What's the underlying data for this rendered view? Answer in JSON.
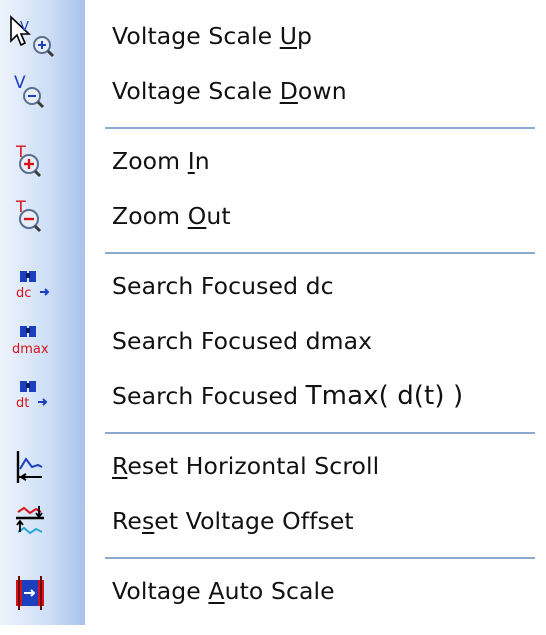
{
  "menu": {
    "items": [
      {
        "id": "voltage-scale-up",
        "pre": "Voltage Scale ",
        "key": "U",
        "post": "p",
        "icon": "voltage-scale-up-icon"
      },
      {
        "id": "voltage-scale-down",
        "pre": "Voltage Scale ",
        "key": "D",
        "post": "own",
        "icon": "voltage-scale-down-icon"
      },
      {
        "id": "zoom-in",
        "pre": "Zoom ",
        "key": "I",
        "post": "n",
        "icon": "zoom-in-icon"
      },
      {
        "id": "zoom-out",
        "pre": "Zoom ",
        "key": "O",
        "post": "ut",
        "icon": "zoom-out-icon"
      },
      {
        "id": "search-focused-dc",
        "label": "Search Focused dc",
        "icon": "binoculars-dc-icon"
      },
      {
        "id": "search-focused-dmax",
        "label": "Search Focused dmax",
        "icon": "binoculars-dmax-icon"
      },
      {
        "id": "search-focused-tmax",
        "pre": "Search Focused ",
        "big": "Tmax( d(t) )",
        "icon": "binoculars-dt-icon"
      },
      {
        "id": "reset-horizontal-scroll",
        "pre": "",
        "key": "R",
        "post": "eset Horizontal Scroll",
        "icon": "reset-horizontal-scroll-icon"
      },
      {
        "id": "reset-voltage-offset",
        "pre": "Re",
        "key": "s",
        "post": "et Voltage Offset",
        "icon": "reset-voltage-offset-icon"
      },
      {
        "id": "voltage-auto-scale",
        "pre": "Voltage ",
        "key": "A",
        "post": "uto Scale",
        "icon": "voltage-auto-scale-icon"
      }
    ],
    "icon_labels": {
      "dc": "dc",
      "dmax": "dmax",
      "dt": "dt",
      "t": "T",
      "v": "V"
    },
    "colors": {
      "gutter_light": "#eef4fd",
      "gutter_dark": "#a9c3ea",
      "separator": "#8ea9cf",
      "text": "#111111",
      "icon_red": "#d8121b",
      "icon_blue": "#1b3fbf"
    }
  }
}
